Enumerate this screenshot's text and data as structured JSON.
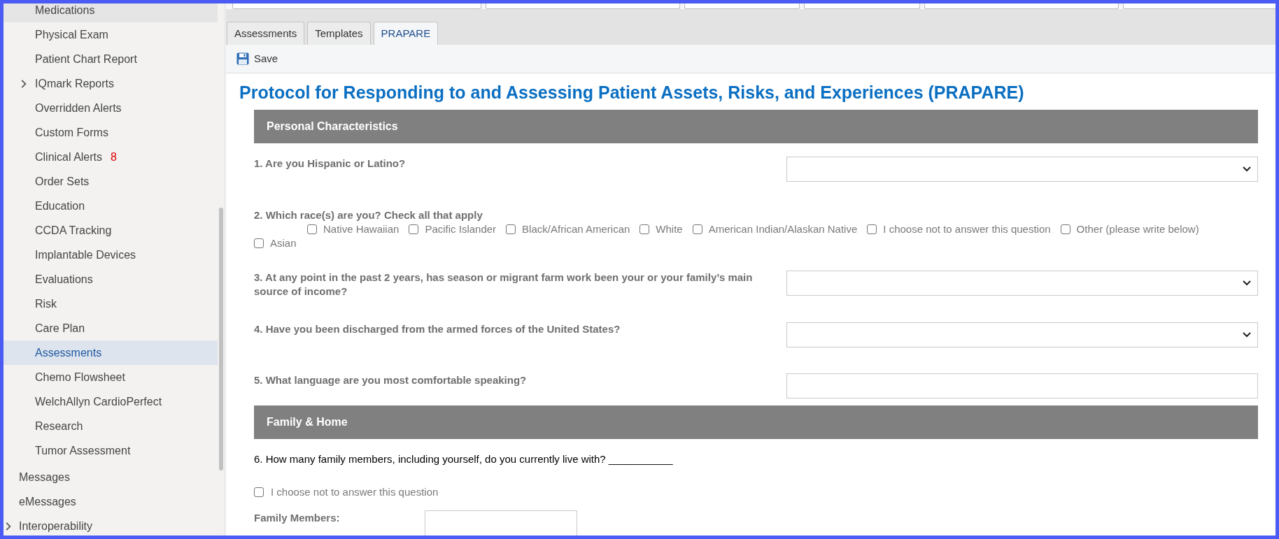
{
  "sidebar": {
    "items": [
      {
        "children": [
          {
            "label": "Medications",
            "selected": false,
            "hovered": true,
            "expandable": false
          },
          {
            "label": "Physical Exam",
            "selected": false,
            "hovered": false,
            "expandable": false
          },
          {
            "label": "Patient Chart Report",
            "selected": false,
            "hovered": false,
            "expandable": false
          },
          {
            "label": "IQmark Reports",
            "selected": false,
            "hovered": false,
            "expandable": true
          },
          {
            "label": "Overridden Alerts",
            "selected": false,
            "hovered": false,
            "expandable": false
          },
          {
            "label": "Custom Forms",
            "selected": false,
            "hovered": false,
            "expandable": false
          },
          {
            "label": "Clinical Alerts",
            "selected": false,
            "hovered": false,
            "expandable": false,
            "count": "8"
          },
          {
            "label": "Order Sets",
            "selected": false,
            "hovered": false,
            "expandable": false
          },
          {
            "label": "Education",
            "selected": false,
            "hovered": false,
            "expandable": false
          },
          {
            "label": "CCDA Tracking",
            "selected": false,
            "hovered": false,
            "expandable": false
          },
          {
            "label": "Implantable Devices",
            "selected": false,
            "hovered": false,
            "expandable": false
          },
          {
            "label": "Evaluations",
            "selected": false,
            "hovered": false,
            "expandable": false
          },
          {
            "label": "Risk",
            "selected": false,
            "hovered": false,
            "expandable": false
          },
          {
            "label": "Care Plan",
            "selected": false,
            "hovered": false,
            "expandable": false
          },
          {
            "label": "Assessments",
            "selected": true,
            "hovered": false,
            "expandable": false
          },
          {
            "label": "Chemo Flowsheet",
            "selected": false,
            "hovered": false,
            "expandable": false
          },
          {
            "label": "WelchAllyn CardioPerfect",
            "selected": false,
            "hovered": false,
            "expandable": false
          },
          {
            "label": "Research",
            "selected": false,
            "hovered": false,
            "expandable": false
          },
          {
            "label": "Tumor Assessment",
            "selected": false,
            "hovered": false,
            "expandable": false
          }
        ]
      },
      {
        "label": "Messages",
        "selected": false,
        "hovered": false,
        "expandable": false
      },
      {
        "label": "eMessages",
        "selected": false,
        "hovered": false,
        "expandable": false
      },
      {
        "label": "Interoperability",
        "selected": false,
        "hovered": false,
        "expandable": true
      }
    ]
  },
  "tabs": [
    {
      "label": "Assessments",
      "selected": false
    },
    {
      "label": "Templates",
      "selected": false
    },
    {
      "label": "PRAPARE",
      "selected": true
    }
  ],
  "toolbar": {
    "buttons": [
      {
        "label": "Save"
      }
    ]
  },
  "form": {
    "title": "Protocol for Responding to and Assessing Patient Assets, Risks, and Experiences (PRAPARE)",
    "sections": [
      {
        "heading": "Personal Characteristics",
        "questions": [
          {
            "kind": "select",
            "label": "1. Are you Hispanic or Latino?"
          },
          {
            "kind": "checkboxes",
            "label": "2. Which race(s) are you? Check all that apply",
            "options": [
              {
                "label": "Native Hawaiian",
                "checked": false
              },
              {
                "label": "Pacific Islander",
                "checked": false
              },
              {
                "label": "Black/African American",
                "checked": false
              },
              {
                "label": "White",
                "checked": false
              },
              {
                "label": "American Indian/Alaskan Native",
                "checked": false
              },
              {
                "label": "I choose not to answer this question",
                "checked": false
              },
              {
                "label": "Other (please write below)",
                "checked": false
              },
              {
                "label": "Asian",
                "checked": false
              }
            ]
          },
          {
            "kind": "select",
            "label": "3. At any point in the past 2 years, has season or migrant farm work been your or your family’s main source of income?"
          },
          {
            "kind": "select",
            "label": "4. Have you been discharged from the armed forces of the United States?"
          },
          {
            "kind": "text",
            "label": "5. What language are you most comfortable speaking?"
          }
        ]
      },
      {
        "heading": "Family & Home",
        "questions": [
          {
            "kind": "statement",
            "label": "6. How many family members, including yourself, do you currently live with? ___________"
          },
          {
            "kind": "checkbox",
            "label": "I choose not to answer this question",
            "checked": false
          },
          {
            "kind": "labeled_text",
            "label": "Family Members:"
          }
        ]
      }
    ]
  }
}
